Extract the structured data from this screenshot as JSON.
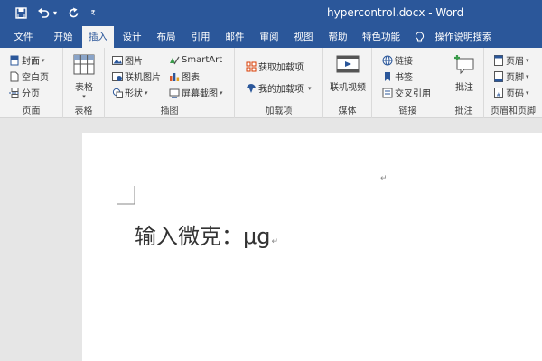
{
  "app": {
    "title": "hypercontrol.docx - Word"
  },
  "quick_access": [
    {
      "name": "save-icon",
      "glyph": "🖫"
    },
    {
      "name": "undo-icon",
      "glyph": "↶"
    },
    {
      "name": "undo-dropdown-icon",
      "glyph": "▾"
    },
    {
      "name": "redo-icon",
      "glyph": "↻"
    },
    {
      "name": "customize-qat-icon",
      "glyph": "₹"
    }
  ],
  "tabs": [
    "文件",
    "开始",
    "插入",
    "设计",
    "布局",
    "引用",
    "邮件",
    "审阅",
    "视图",
    "帮助",
    "特色功能",
    "操作说明搜索"
  ],
  "active_tab": "插入",
  "ribbon": {
    "pages": {
      "label": "页面",
      "cover": "封面",
      "blank": "空白页",
      "break": "分页"
    },
    "tables": {
      "label": "表格",
      "table": "表格"
    },
    "illustrations": {
      "label": "插图",
      "pictures": "图片",
      "online_pictures": "联机图片",
      "shapes": "形状",
      "smartart": "SmartArt",
      "chart": "图表",
      "screenshot": "屏幕截图"
    },
    "addins": {
      "label": "加载项",
      "get": "获取加载项",
      "mine": "我的加载项"
    },
    "media": {
      "label": "媒体",
      "online_video": "联机视频"
    },
    "links": {
      "label": "链接",
      "link": "链接",
      "bookmark": "书签",
      "cross_ref": "交叉引用"
    },
    "comments": {
      "label": "批注",
      "comment": "批注"
    },
    "header_footer": {
      "label": "页眉和页脚",
      "header": "页眉",
      "footer": "页脚",
      "page_number": "页码"
    }
  },
  "document": {
    "text": "输入微克：μg",
    "paragraph_mark": "↵"
  },
  "colors": {
    "accent": "#2b579a",
    "ribbon": "#f3f3f3"
  }
}
